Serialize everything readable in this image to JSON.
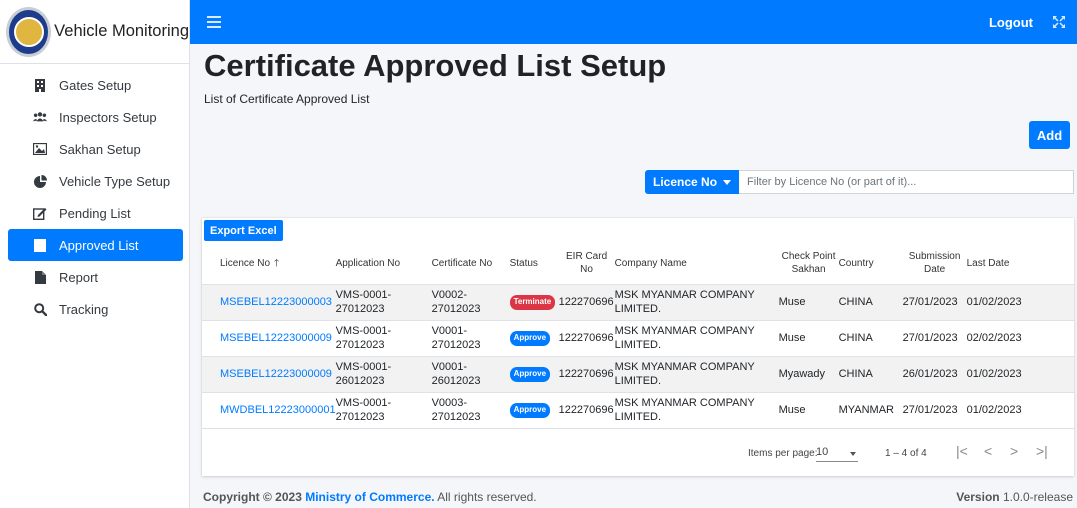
{
  "brand": {
    "name": "Vehicle Monitoring"
  },
  "sidebar": {
    "items": [
      {
        "label": "Gates Setup",
        "icon": "building-icon"
      },
      {
        "label": "Inspectors Setup",
        "icon": "users-icon"
      },
      {
        "label": "Sakhan Setup",
        "icon": "image-icon"
      },
      {
        "label": "Vehicle Type Setup",
        "icon": "pie-chart-icon"
      },
      {
        "label": "Pending List",
        "icon": "edit-icon"
      },
      {
        "label": "Approved List",
        "icon": "list-icon",
        "active": true
      },
      {
        "label": "Report",
        "icon": "file-icon"
      },
      {
        "label": "Tracking",
        "icon": "search-icon"
      }
    ]
  },
  "topbar": {
    "logout_label": "Logout"
  },
  "page": {
    "title": "Certificate Approved List Setup",
    "subtitle": "List of Certificate Approved List",
    "add_label": "Add"
  },
  "filter": {
    "field_label": "Licence No",
    "placeholder": "Filter by Licence No (or part of it)..."
  },
  "table": {
    "export_label": "Export Excel",
    "headers": {
      "licence_no": "Licence No",
      "application_no": "Application No",
      "certificate_no": "Certificate No",
      "status": "Status",
      "eir_card_no": "EIR Card No",
      "company_name": "Company Name",
      "check_point": "Check Point Sakhan",
      "country": "Country",
      "submission_date": "Submission Date",
      "last_date": "Last Date"
    },
    "rows": [
      {
        "licence_no": "MSEBEL12223000003",
        "application_no": "VMS-0001-27012023",
        "certificate_no": "V0002-27012023",
        "status": "Terminate",
        "eir_card_no": "122270696",
        "company_name": "MSK MYANMAR COMPANY LIMITED.",
        "check_point": "Muse",
        "country": "CHINA",
        "submission_date": "27/01/2023",
        "last_date": "01/02/2023"
      },
      {
        "licence_no": "MSEBEL12223000009",
        "application_no": "VMS-0001-27012023",
        "certificate_no": "V0001-27012023",
        "status": "Approve",
        "eir_card_no": "122270696",
        "company_name": "MSK MYANMAR COMPANY LIMITED.",
        "check_point": "Muse",
        "country": "CHINA",
        "submission_date": "27/01/2023",
        "last_date": "02/02/2023"
      },
      {
        "licence_no": "MSEBEL12223000009",
        "application_no": "VMS-0001-26012023",
        "certificate_no": "V0001-26012023",
        "status": "Approve",
        "eir_card_no": "122270696",
        "company_name": "MSK MYANMAR COMPANY LIMITED.",
        "check_point": "Myawady",
        "country": "CHINA",
        "submission_date": "26/01/2023",
        "last_date": "01/02/2023"
      },
      {
        "licence_no": "MWDBEL12223000001",
        "application_no": "VMS-0001-27012023",
        "certificate_no": "V0003-27012023",
        "status": "Approve",
        "eir_card_no": "122270696",
        "company_name": "MSK MYANMAR COMPANY LIMITED.",
        "check_point": "Muse",
        "country": "MYANMAR",
        "submission_date": "27/01/2023",
        "last_date": "01/02/2023"
      }
    ],
    "status_colors": {
      "Terminate": "#dc3545",
      "Approve": "#007bff"
    }
  },
  "pager": {
    "items_per_page_label": "Items per page:",
    "items_per_page": "10",
    "range": "1 – 4 of 4"
  },
  "footer": {
    "copyright_prefix": "Copyright © 2023",
    "org": "Ministry of Commerce.",
    "rights": "All rights reserved.",
    "version_label": "Version",
    "version": "1.0.0-release"
  },
  "colors": {
    "primary": "#007bff",
    "danger": "#dc3545"
  }
}
